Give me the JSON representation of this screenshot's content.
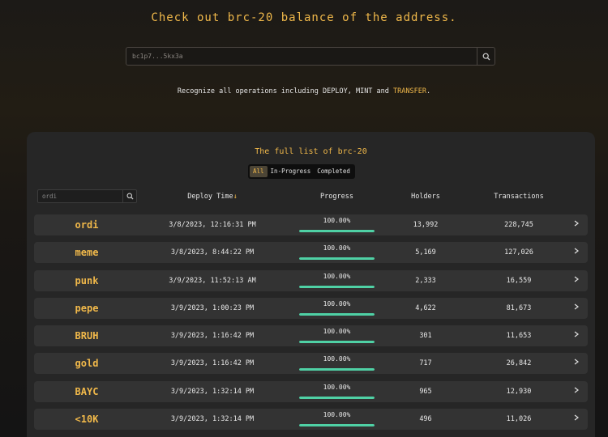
{
  "hero": {
    "title": "Check out brc-20 balance of the address."
  },
  "address_search": {
    "placeholder": "bc1p7...5kx3a",
    "icon": "search-icon"
  },
  "subtitle": {
    "text": "Recognize all operations including DEPLOY, MINT and ",
    "highlight": "TRANSFER",
    "end": "."
  },
  "panel": {
    "title": "The full list of brc-20",
    "filters": [
      {
        "label": "All",
        "active": true
      },
      {
        "label": "In-Progress",
        "active": false
      },
      {
        "label": "Completed",
        "active": false
      }
    ],
    "tick_search": {
      "placeholder": "ordi",
      "icon": "search-icon"
    },
    "columns": {
      "deploy_time": "Deploy Time",
      "sort_arrow": "↓",
      "progress": "Progress",
      "holders": "Holders",
      "transactions": "Transactions"
    }
  },
  "tokens": [
    {
      "tick": "ordi",
      "deploy_time": "3/8/2023, 12:16:31 PM",
      "progress": "100.00%",
      "progress_value": 100,
      "holders": "13,992",
      "transactions": "228,745"
    },
    {
      "tick": "meme",
      "deploy_time": "3/8/2023, 8:44:22 PM",
      "progress": "100.00%",
      "progress_value": 100,
      "holders": "5,169",
      "transactions": "127,026"
    },
    {
      "tick": "punk",
      "deploy_time": "3/9/2023, 11:52:13 AM",
      "progress": "100.00%",
      "progress_value": 100,
      "holders": "2,333",
      "transactions": "16,559"
    },
    {
      "tick": "pepe",
      "deploy_time": "3/9/2023, 1:00:23 PM",
      "progress": "100.00%",
      "progress_value": 100,
      "holders": "4,622",
      "transactions": "81,673"
    },
    {
      "tick": "BRUH",
      "deploy_time": "3/9/2023, 1:16:42 PM",
      "progress": "100.00%",
      "progress_value": 100,
      "holders": "301",
      "transactions": "11,653"
    },
    {
      "tick": "gold",
      "deploy_time": "3/9/2023, 1:16:42 PM",
      "progress": "100.00%",
      "progress_value": 100,
      "holders": "717",
      "transactions": "26,842"
    },
    {
      "tick": "BAYC",
      "deploy_time": "3/9/2023, 1:32:14 PM",
      "progress": "100.00%",
      "progress_value": 100,
      "holders": "965",
      "transactions": "12,930"
    },
    {
      "tick": "<10K",
      "deploy_time": "3/9/2023, 1:32:14 PM",
      "progress": "100.00%",
      "progress_value": 100,
      "holders": "496",
      "transactions": "11,026"
    }
  ],
  "colors": {
    "accent": "#f0b84a",
    "progress": "#4fd1a5",
    "row_bg": "#333333",
    "panel_bg": "#262626"
  }
}
